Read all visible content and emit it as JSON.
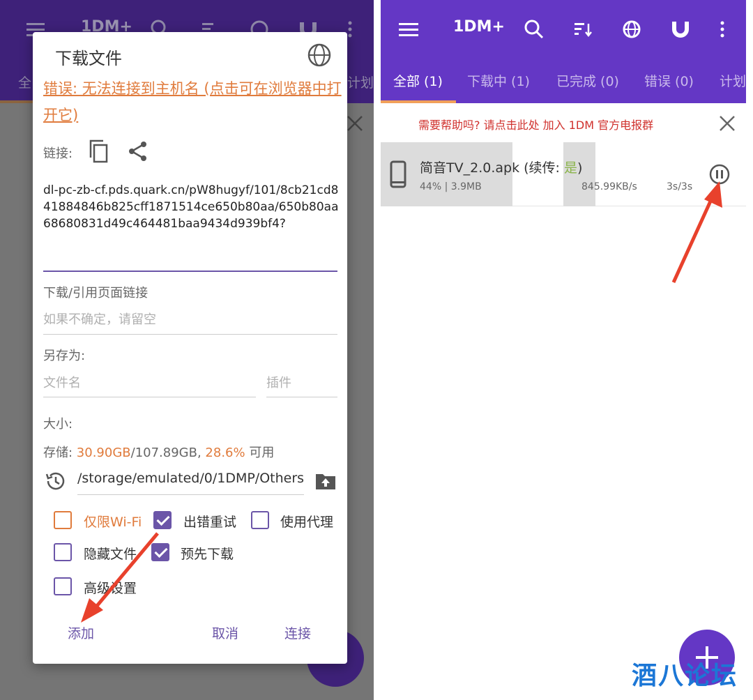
{
  "left": {
    "toolbar": {
      "title": "1DM+",
      "tab_first": "全",
      "tab_last": "计划"
    },
    "dialog": {
      "title": "下载文件",
      "error": "错误: 无法连接到主机名 (点击可在浏览器中打开它)",
      "link_label": "链接:",
      "url": "dl-pc-zb-cf.pds.quark.cn/pW8hugyf/101/8cb21cd841884846b825cff1871514ce650b80aa/650b80aa68680831d49c464481baa9434d939bf4?",
      "referer_label": "下载/引用页面链接",
      "referer_placeholder": "如果不确定，请留空",
      "saveas_label": "另存为:",
      "filename_placeholder": "文件名",
      "plugin_placeholder": "插件",
      "size_label": "大小:",
      "storage_prefix": "存储: ",
      "storage_used": "30.90GB",
      "storage_total": "/107.89GB, ",
      "storage_pct": "28.6%",
      "storage_suffix": " 可用",
      "path": "/storage/emulated/0/1DMP/Others",
      "checkboxes": {
        "wifi_only": "仅限Wi-Fi",
        "retry_on_error": "出错重试",
        "use_proxy": "使用代理",
        "hide_file": "隐藏文件",
        "pre_download": "预先下载",
        "advanced": "高级设置"
      },
      "buttons": {
        "add": "添加",
        "cancel": "取消",
        "connect": "连接"
      }
    }
  },
  "right": {
    "toolbar": {
      "title": "1DM+"
    },
    "tabs": [
      {
        "label": "全部 (1)",
        "active": true
      },
      {
        "label": "下载中 (1)",
        "active": false
      },
      {
        "label": "已完成 (0)",
        "active": false
      },
      {
        "label": "错误 (0)",
        "active": false
      },
      {
        "label": "计划",
        "active": false
      }
    ],
    "help_banner": "需要帮助吗? 请点击此处 加入 1DM 官方电报群",
    "download": {
      "filename": "简音TV_2.0.apk",
      "resume_prefix": " (续传: ",
      "resume_value": "是",
      "resume_suffix": ")",
      "progress_text": "44% | 3.9MB",
      "progress": 0.44,
      "speed": "845.99KB/s",
      "time": "3s/3s"
    },
    "watermark": "酒八论坛"
  },
  "colors": {
    "toolbar": "#6437c5",
    "accent": "#6b55a8",
    "error": "#e07b3c",
    "banner_text": "#d0312d",
    "tab_indicator": "#f0a05a",
    "arrow": "#e8412c"
  }
}
